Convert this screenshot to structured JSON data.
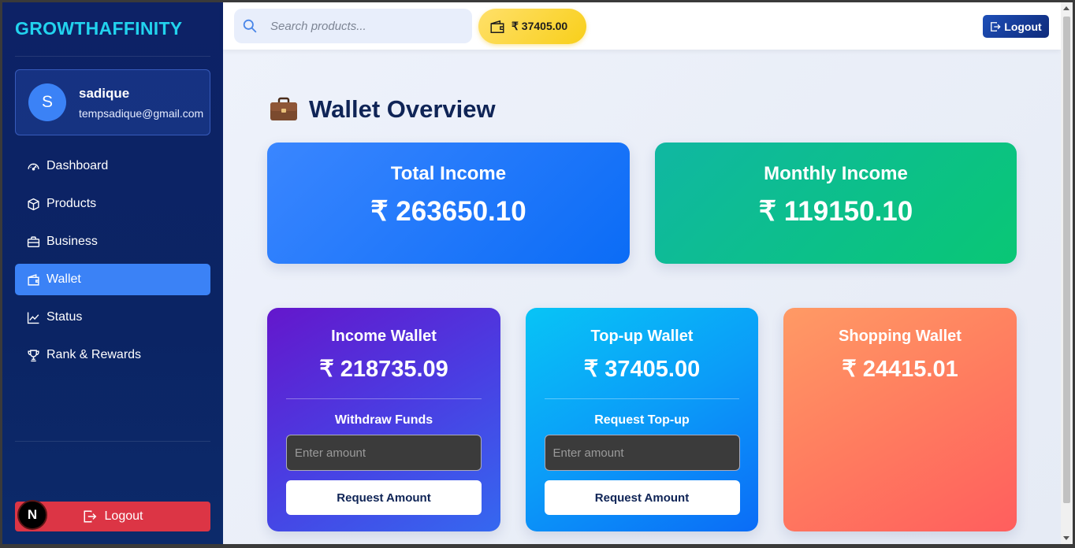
{
  "sidebar": {
    "brand": "GROWTHAFFINITY",
    "profile": {
      "initial": "S",
      "name": "sadique",
      "email": "tempsadique@gmail.com"
    },
    "nav": [
      {
        "label": "Dashboard",
        "icon": "gauge-icon",
        "active": false
      },
      {
        "label": "Products",
        "icon": "box-icon",
        "active": false
      },
      {
        "label": "Business",
        "icon": "briefcase-icon",
        "active": false
      },
      {
        "label": "Wallet",
        "icon": "wallet-icon",
        "active": true
      },
      {
        "label": "Status",
        "icon": "line-chart-icon",
        "active": false
      },
      {
        "label": "Rank & Rewards",
        "icon": "trophy-icon",
        "active": false
      }
    ],
    "logout_label": "Logout",
    "framework_badge": "N"
  },
  "topbar": {
    "search_placeholder": "Search products...",
    "balance": "₹ 37405.00",
    "logout_label": "Logout"
  },
  "page": {
    "title": "Wallet Overview",
    "total_income": {
      "title": "Total Income",
      "value": "₹ 263650.10"
    },
    "monthly_income": {
      "title": "Monthly Income",
      "value": "₹ 119150.10"
    },
    "income_wallet": {
      "title": "Income Wallet",
      "value": "₹ 218735.09",
      "subtitle": "Withdraw Funds",
      "placeholder": "Enter amount",
      "button": "Request Amount"
    },
    "topup_wallet": {
      "title": "Top-up Wallet",
      "value": "₹ 37405.00",
      "subtitle": "Request Top-up",
      "placeholder": "Enter amount",
      "button": "Request Amount"
    },
    "shopping_wallet": {
      "title": "Shopping Wallet",
      "value": "₹ 24415.01"
    }
  },
  "colors": {
    "sidebar_bg": "#0d2266",
    "brand": "#22d3ee",
    "active_nav": "#3b82f6",
    "logout_red": "#dc3545",
    "balance_yellow": "#f8cf1a"
  }
}
